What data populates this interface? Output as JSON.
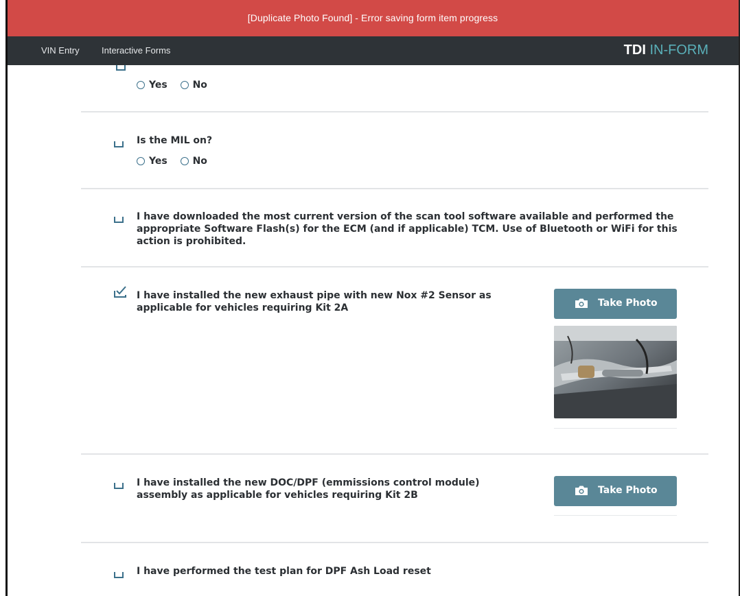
{
  "error_bar": {
    "message": "[Duplicate Photo Found] - Error saving form item progress",
    "color": "#d24a47"
  },
  "nav": {
    "items": [
      "VIN Entry",
      "Interactive Forms"
    ],
    "brand_primary": "TDI",
    "brand_secondary": "IN-FORM",
    "bar_color": "#2e3337",
    "brand_accent": "#5ab0b9"
  },
  "form": {
    "radio_yes": "Yes",
    "radio_no": "No",
    "photo_button_label": "Take Photo",
    "button_color": "#5a8797",
    "check_color": "#3a6f8a",
    "items": [
      {
        "text": "Is the MIL on?"
      },
      {
        "text": "I have downloaded the most current version of the scan tool software available and performed the appropriate Software Flash(s) for the ECM (and if applicable) TCM. Use of Bluetooth or WiFi for this action is prohibited."
      },
      {
        "text": "I have installed the new exhaust pipe with new Nox #2 Sensor as applicable for vehicles requiring Kit 2A",
        "checked": true
      },
      {
        "text": "I have installed the new DOC/DPF (emmissions control module) assembly as applicable for vehicles requiring Kit 2B"
      },
      {
        "text": "I have performed the test plan for DPF Ash Load reset"
      }
    ]
  }
}
